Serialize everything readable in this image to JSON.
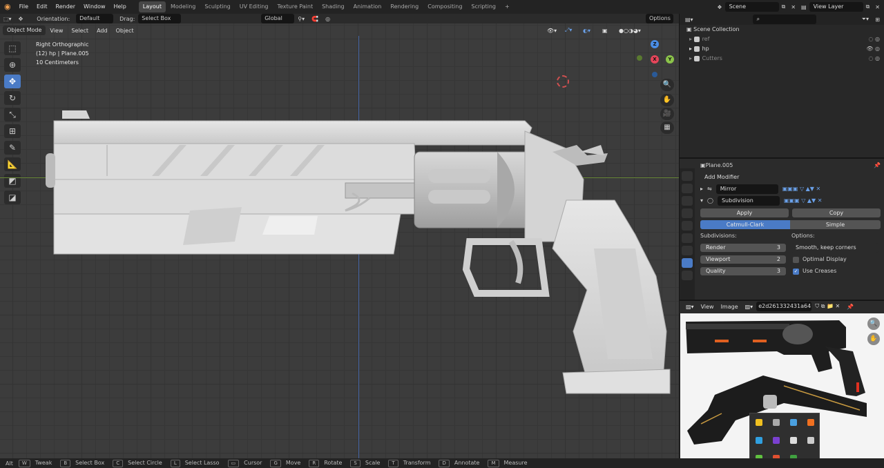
{
  "topbar": {
    "menu": [
      "File",
      "Edit",
      "Render",
      "Window",
      "Help"
    ],
    "workspaces": [
      "Layout",
      "Modeling",
      "Sculpting",
      "UV Editing",
      "Texture Paint",
      "Shading",
      "Animation",
      "Rendering",
      "Compositing",
      "Scripting",
      "+"
    ],
    "active_workspace": "Layout",
    "scene": "Scene",
    "view_layer": "View Layer"
  },
  "viewport": {
    "orientation_label": "Orientation:",
    "orientation_value": "Default",
    "drag_label": "Drag:",
    "drag_value": "Select Box",
    "transform_orientation": "Global",
    "options": "Options",
    "mode": "Object Mode",
    "menus": [
      "View",
      "Select",
      "Add",
      "Object"
    ],
    "info_line1": "Right Orthographic",
    "info_line2": "(12) hp | Plane.005",
    "info_line3": "10 Centimeters",
    "gizmo_axes": {
      "z": "Z",
      "x": "X",
      "y": "Y"
    }
  },
  "outliner": {
    "root": "Scene Collection",
    "items": [
      {
        "label": "ref"
      },
      {
        "label": "hp"
      },
      {
        "label": "Cutters"
      }
    ]
  },
  "properties": {
    "object_name": "Plane.005",
    "add_modifier": "Add Modifier",
    "modifiers": [
      {
        "name": "Mirror"
      },
      {
        "name": "Subdivision"
      }
    ],
    "apply": "Apply",
    "copy": "Copy",
    "catmull": "Catmull-Clark",
    "simple": "Simple",
    "subdivisions_label": "Subdivisions:",
    "options_label": "Options:",
    "render_label": "Render",
    "render_value": "3",
    "viewport_label": "Viewport",
    "viewport_value": "2",
    "quality_label": "Quality",
    "quality_value": "3",
    "uv_smooth": "Smooth, keep corners",
    "optimal_display": "Optimal Display",
    "use_creases": "Use Creases"
  },
  "image_editor": {
    "menus": [
      "View",
      "Image"
    ],
    "image_name": "e2d261332431a64..."
  },
  "statusbar": {
    "items": [
      {
        "key": "Alt",
        "label": ""
      },
      {
        "key": "W",
        "label": "Tweak"
      },
      {
        "key": "B",
        "label": "Select Box"
      },
      {
        "key": "C",
        "label": "Select Circle"
      },
      {
        "key": "L",
        "label": "Select Lasso"
      },
      {
        "key": "",
        "label": "Cursor"
      },
      {
        "key": "G",
        "label": "Move"
      },
      {
        "key": "R",
        "label": "Rotate"
      },
      {
        "key": "S",
        "label": "Scale"
      },
      {
        "key": "T",
        "label": "Transform"
      },
      {
        "key": "D",
        "label": "Annotate"
      },
      {
        "key": "M",
        "label": "Measure"
      }
    ]
  },
  "colors": {
    "accent": "#4a7bc6",
    "x_axis": "#e5455a",
    "y_axis": "#8bc34a",
    "z_axis": "#4a8de6"
  }
}
